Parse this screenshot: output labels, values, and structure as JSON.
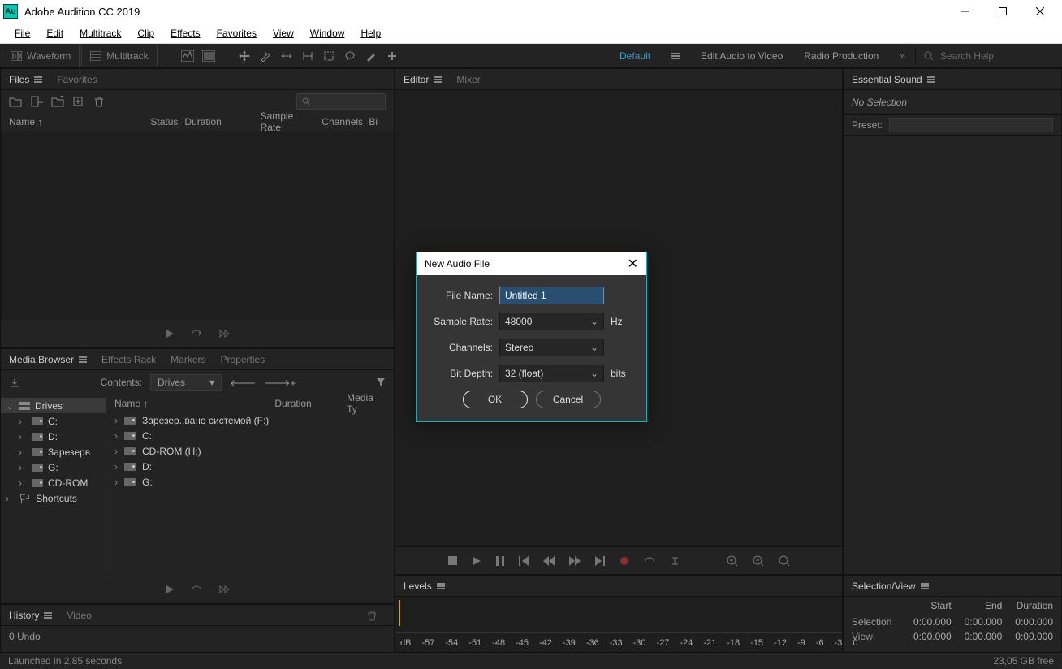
{
  "titlebar": {
    "app_title": "Adobe Audition CC 2019",
    "logo_text": "Au"
  },
  "menubar": [
    "File",
    "Edit",
    "Multitrack",
    "Clip",
    "Effects",
    "Favorites",
    "View",
    "Window",
    "Help"
  ],
  "mode_buttons": {
    "waveform": "Waveform",
    "multitrack": "Multitrack"
  },
  "workspaces": {
    "default": "Default",
    "edit_audio": "Edit Audio to Video",
    "radio": "Radio Production",
    "more": "»"
  },
  "search_placeholder": "Search Help",
  "files_panel": {
    "tabs": {
      "files": "Files",
      "favorites": "Favorites"
    },
    "columns": {
      "name": "Name ↑",
      "status": "Status",
      "duration": "Duration",
      "sample_rate": "Sample Rate",
      "channels": "Channels",
      "bit": "Bi"
    }
  },
  "media_browser": {
    "tabs": {
      "mb": "Media Browser",
      "fx": "Effects Rack",
      "markers": "Markers",
      "props": "Properties"
    },
    "contents_label": "Contents:",
    "contents_value": "Drives",
    "tree": [
      {
        "label": "Drives",
        "sel": true,
        "icon": "drives"
      },
      {
        "label": "C:",
        "icon": "hdd"
      },
      {
        "label": "D:",
        "icon": "hdd"
      },
      {
        "label": "Зарезерв",
        "icon": "hdd"
      },
      {
        "label": "G:",
        "icon": "hdd"
      },
      {
        "label": "CD-ROM",
        "icon": "hdd"
      },
      {
        "label": "Shortcuts",
        "icon": "flag"
      }
    ],
    "list_cols": {
      "name": "Name ↑",
      "duration": "Duration",
      "media_type": "Media Ty"
    },
    "list": [
      {
        "label": "Зарезер..вано системой (F:)",
        "icon": "hdd"
      },
      {
        "label": "C:",
        "icon": "hdd"
      },
      {
        "label": "CD-ROM (H:)",
        "icon": "hdd"
      },
      {
        "label": "D:",
        "icon": "hdd"
      },
      {
        "label": "G:",
        "icon": "hdd"
      }
    ]
  },
  "history": {
    "tabs": {
      "history": "History",
      "video": "Video"
    },
    "undo": "0 Undo"
  },
  "editor": {
    "tabs": {
      "editor": "Editor",
      "mixer": "Mixer"
    }
  },
  "levels": {
    "tab": "Levels",
    "db": [
      "dB",
      "-57",
      "-54",
      "-51",
      "-48",
      "-45",
      "-42",
      "-39",
      "-36",
      "-33",
      "-30",
      "-27",
      "-24",
      "-21",
      "-18",
      "-15",
      "-12",
      "-9",
      "-6",
      "-3",
      "0"
    ]
  },
  "essential_sound": {
    "tab": "Essential Sound",
    "no_selection": "No Selection",
    "preset_label": "Preset:"
  },
  "selection_view": {
    "tab": "Selection/View",
    "cols": {
      "start": "Start",
      "end": "End",
      "duration": "Duration"
    },
    "rows": [
      {
        "label": "Selection",
        "start": "0:00.000",
        "end": "0:00.000",
        "duration": "0:00.000"
      },
      {
        "label": "View",
        "start": "0:00.000",
        "end": "0:00.000",
        "duration": "0:00.000"
      }
    ]
  },
  "statusbar": {
    "launch": "Launched in 2,85 seconds",
    "free": "23,05 GB free"
  },
  "dialog": {
    "title": "New Audio File",
    "file_name_label": "File Name:",
    "file_name_value": "Untitled 1",
    "sample_rate_label": "Sample Rate:",
    "sample_rate_value": "48000",
    "sample_rate_unit": "Hz",
    "channels_label": "Channels:",
    "channels_value": "Stereo",
    "bit_depth_label": "Bit Depth:",
    "bit_depth_value": "32 (float)",
    "bit_depth_unit": "bits",
    "ok": "OK",
    "cancel": "Cancel"
  }
}
